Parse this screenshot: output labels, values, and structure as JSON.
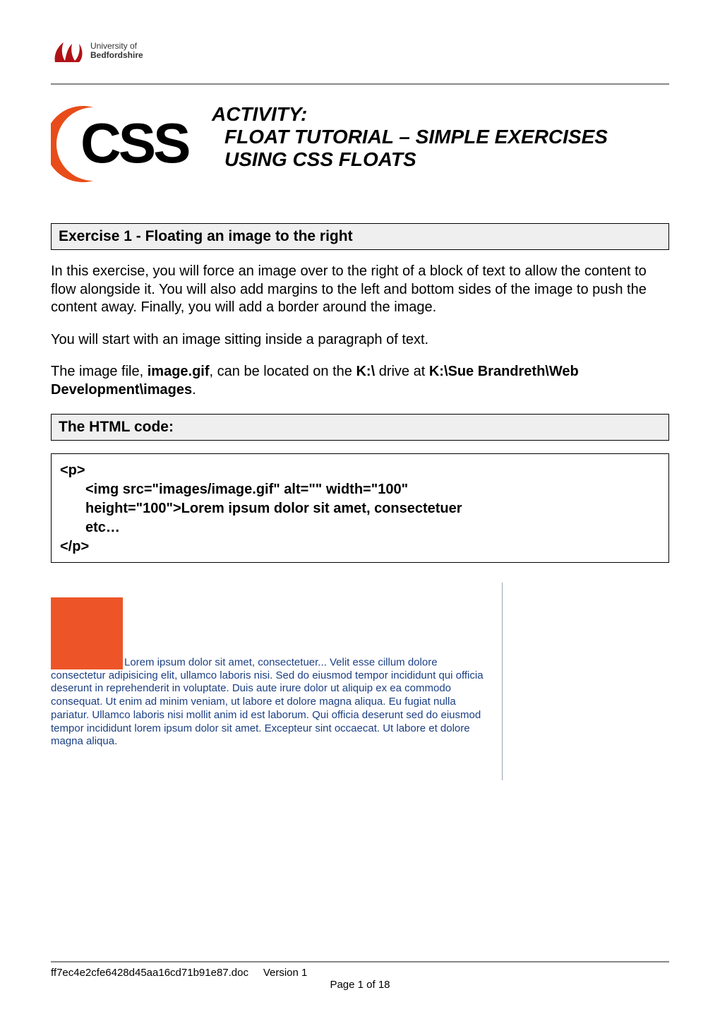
{
  "header": {
    "logo_line1": "University of",
    "logo_line2": "Bedfordshire"
  },
  "activity": {
    "activity_label": "ACTIVITY:",
    "line1": "FLOAT TUTORIAL – SIMPLE EXERCISES",
    "line2": "USING CSS FLOATS"
  },
  "css_badge_text": "CSS",
  "exercise1": {
    "heading": "Exercise 1 - Floating an image to the right",
    "p1": "In this exercise, you will force an image over to the right of a block of text to allow the content to flow alongside it.  You will also add margins to the left and bottom sides of the image to push the content away.  Finally, you will add a border around the image.",
    "p2": "You will start with an image sitting inside a paragraph of text.",
    "p3_pre": "The image file, ",
    "p3_code1": "image.gif",
    "p3_mid": ", can be located on the ",
    "p3_code2": "K:\\",
    "p3_mid2": " drive at ",
    "p3_code3": "K:\\Sue Brandreth\\Web Development\\images",
    "p3_post": "."
  },
  "html_code_heading": "The HTML code:",
  "code_lines": {
    "l1": "<p>",
    "l2": "<img src=\"images/image.gif\" alt=\"\" width=\"100\"",
    "l3": "height=\"100\">Lorem ipsum dolor sit amet, consectetuer",
    "l4": "etc…",
    "l5": "</p>"
  },
  "example_text": "Lorem ipsum dolor sit amet, consectetuer... Velit esse cillum dolore consectetur adipisicing elit, ullamco laboris nisi. Sed do eiusmod tempor incididunt qui officia deserunt in reprehenderit in voluptate. Duis aute irure dolor ut aliquip ex ea commodo consequat. Ut enim ad minim veniam, ut labore et dolore magna aliqua. Eu fugiat nulla pariatur. Ullamco laboris nisi mollit anim id est laborum. Qui officia deserunt sed do eiusmod tempor incididunt lorem ipsum dolor sit amet. Excepteur sint occaecat. Ut labore et dolore magna aliqua.",
  "footer": {
    "filename": "ff7ec4e2cfe6428d45aa16cd71b91e87.doc",
    "version": "Version 1",
    "page": "Page 1 of 18"
  }
}
